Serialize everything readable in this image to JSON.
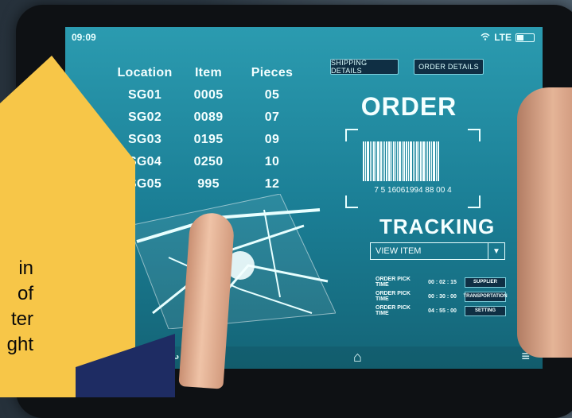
{
  "status_bar": {
    "time": "09:09",
    "network": "LTE"
  },
  "table": {
    "headers": [
      "Location",
      "Item",
      "Pieces"
    ],
    "rows": [
      [
        "SG01",
        "0005",
        "05"
      ],
      [
        "SG02",
        "0089",
        "07"
      ],
      [
        "SG03",
        "0195",
        "09"
      ],
      [
        "SG04",
        "0250",
        "10"
      ],
      [
        "SG05",
        "995",
        "12"
      ]
    ]
  },
  "buttons": {
    "shipping_details": "SHIPPING DETAILS",
    "order_details": "ORDER DETAILS"
  },
  "order": {
    "title": "ORDER",
    "barcode_number": "7 5 16061994 88 00 4"
  },
  "tracking": {
    "title": "TRACKING",
    "select_value": "VIEW ITEM",
    "pick_rows": [
      {
        "label": "ORDER PICK TIME",
        "time": "00 : 02 : 15",
        "button": "SUPPLIER"
      },
      {
        "label": "ORDER PICK TIME",
        "time": "00 : 30 : 00",
        "button": "TRANSPORTATION"
      },
      {
        "label": "ORDER PICK TIME",
        "time": "04 : 55 : 00",
        "button": "SETTING"
      }
    ]
  },
  "nav_icons": {
    "back": "back-icon",
    "home": "home-icon",
    "menu": "menu-icon"
  },
  "overlay_text_fragments": [
    "in",
    "of",
    "ter",
    "ght"
  ],
  "colors": {
    "screen_teal": "#1f8ea4",
    "overlay_yellow": "#f7c648",
    "overlay_navy": "#1e2c63"
  }
}
